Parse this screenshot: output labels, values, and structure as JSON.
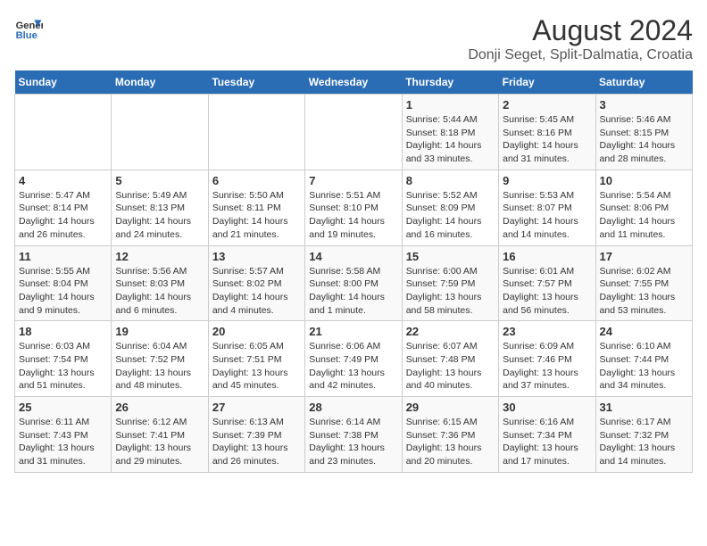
{
  "header": {
    "logo_line1": "General",
    "logo_line2": "Blue",
    "title": "August 2024",
    "subtitle": "Donji Seget, Split-Dalmatia, Croatia"
  },
  "days_of_week": [
    "Sunday",
    "Monday",
    "Tuesday",
    "Wednesday",
    "Thursday",
    "Friday",
    "Saturday"
  ],
  "weeks": [
    [
      {
        "num": "",
        "detail": ""
      },
      {
        "num": "",
        "detail": ""
      },
      {
        "num": "",
        "detail": ""
      },
      {
        "num": "",
        "detail": ""
      },
      {
        "num": "1",
        "detail": "Sunrise: 5:44 AM\nSunset: 8:18 PM\nDaylight: 14 hours and 33 minutes."
      },
      {
        "num": "2",
        "detail": "Sunrise: 5:45 AM\nSunset: 8:16 PM\nDaylight: 14 hours and 31 minutes."
      },
      {
        "num": "3",
        "detail": "Sunrise: 5:46 AM\nSunset: 8:15 PM\nDaylight: 14 hours and 28 minutes."
      }
    ],
    [
      {
        "num": "4",
        "detail": "Sunrise: 5:47 AM\nSunset: 8:14 PM\nDaylight: 14 hours and 26 minutes."
      },
      {
        "num": "5",
        "detail": "Sunrise: 5:49 AM\nSunset: 8:13 PM\nDaylight: 14 hours and 24 minutes."
      },
      {
        "num": "6",
        "detail": "Sunrise: 5:50 AM\nSunset: 8:11 PM\nDaylight: 14 hours and 21 minutes."
      },
      {
        "num": "7",
        "detail": "Sunrise: 5:51 AM\nSunset: 8:10 PM\nDaylight: 14 hours and 19 minutes."
      },
      {
        "num": "8",
        "detail": "Sunrise: 5:52 AM\nSunset: 8:09 PM\nDaylight: 14 hours and 16 minutes."
      },
      {
        "num": "9",
        "detail": "Sunrise: 5:53 AM\nSunset: 8:07 PM\nDaylight: 14 hours and 14 minutes."
      },
      {
        "num": "10",
        "detail": "Sunrise: 5:54 AM\nSunset: 8:06 PM\nDaylight: 14 hours and 11 minutes."
      }
    ],
    [
      {
        "num": "11",
        "detail": "Sunrise: 5:55 AM\nSunset: 8:04 PM\nDaylight: 14 hours and 9 minutes."
      },
      {
        "num": "12",
        "detail": "Sunrise: 5:56 AM\nSunset: 8:03 PM\nDaylight: 14 hours and 6 minutes."
      },
      {
        "num": "13",
        "detail": "Sunrise: 5:57 AM\nSunset: 8:02 PM\nDaylight: 14 hours and 4 minutes."
      },
      {
        "num": "14",
        "detail": "Sunrise: 5:58 AM\nSunset: 8:00 PM\nDaylight: 14 hours and 1 minute."
      },
      {
        "num": "15",
        "detail": "Sunrise: 6:00 AM\nSunset: 7:59 PM\nDaylight: 13 hours and 58 minutes."
      },
      {
        "num": "16",
        "detail": "Sunrise: 6:01 AM\nSunset: 7:57 PM\nDaylight: 13 hours and 56 minutes."
      },
      {
        "num": "17",
        "detail": "Sunrise: 6:02 AM\nSunset: 7:55 PM\nDaylight: 13 hours and 53 minutes."
      }
    ],
    [
      {
        "num": "18",
        "detail": "Sunrise: 6:03 AM\nSunset: 7:54 PM\nDaylight: 13 hours and 51 minutes."
      },
      {
        "num": "19",
        "detail": "Sunrise: 6:04 AM\nSunset: 7:52 PM\nDaylight: 13 hours and 48 minutes."
      },
      {
        "num": "20",
        "detail": "Sunrise: 6:05 AM\nSunset: 7:51 PM\nDaylight: 13 hours and 45 minutes."
      },
      {
        "num": "21",
        "detail": "Sunrise: 6:06 AM\nSunset: 7:49 PM\nDaylight: 13 hours and 42 minutes."
      },
      {
        "num": "22",
        "detail": "Sunrise: 6:07 AM\nSunset: 7:48 PM\nDaylight: 13 hours and 40 minutes."
      },
      {
        "num": "23",
        "detail": "Sunrise: 6:09 AM\nSunset: 7:46 PM\nDaylight: 13 hours and 37 minutes."
      },
      {
        "num": "24",
        "detail": "Sunrise: 6:10 AM\nSunset: 7:44 PM\nDaylight: 13 hours and 34 minutes."
      }
    ],
    [
      {
        "num": "25",
        "detail": "Sunrise: 6:11 AM\nSunset: 7:43 PM\nDaylight: 13 hours and 31 minutes."
      },
      {
        "num": "26",
        "detail": "Sunrise: 6:12 AM\nSunset: 7:41 PM\nDaylight: 13 hours and 29 minutes."
      },
      {
        "num": "27",
        "detail": "Sunrise: 6:13 AM\nSunset: 7:39 PM\nDaylight: 13 hours and 26 minutes."
      },
      {
        "num": "28",
        "detail": "Sunrise: 6:14 AM\nSunset: 7:38 PM\nDaylight: 13 hours and 23 minutes."
      },
      {
        "num": "29",
        "detail": "Sunrise: 6:15 AM\nSunset: 7:36 PM\nDaylight: 13 hours and 20 minutes."
      },
      {
        "num": "30",
        "detail": "Sunrise: 6:16 AM\nSunset: 7:34 PM\nDaylight: 13 hours and 17 minutes."
      },
      {
        "num": "31",
        "detail": "Sunrise: 6:17 AM\nSunset: 7:32 PM\nDaylight: 13 hours and 14 minutes."
      }
    ]
  ]
}
